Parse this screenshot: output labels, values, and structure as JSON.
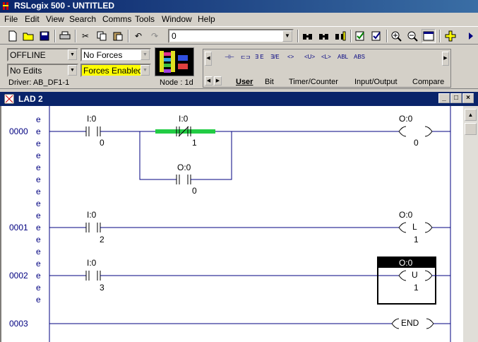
{
  "window": {
    "title": "RSLogix 500 - UNTITLED"
  },
  "menu": [
    "File",
    "Edit",
    "View",
    "Search",
    "Comms",
    "Tools",
    "Window",
    "Help"
  ],
  "toolbar": {
    "combo_value": "0"
  },
  "status": {
    "mode": "OFFLINE",
    "edits": "No Edits",
    "forces": "No Forces",
    "forces_enabled": "Forces Enabled",
    "driver": "Driver: AB_DF1-1",
    "node": "Node :  1d"
  },
  "palette": {
    "icons": [
      "⊣⊢",
      "⊏⊐",
      "∃ E",
      "∃/E",
      "<>",
      "<U>",
      "<L>",
      "ABL",
      "ABS"
    ],
    "tabs": [
      "User",
      "Bit",
      "Timer/Counter",
      "Input/Output",
      "Compare"
    ]
  },
  "lad": {
    "title": "LAD 2"
  },
  "rungs": [
    {
      "number": "0000"
    },
    {
      "number": "0001"
    },
    {
      "number": "0002"
    },
    {
      "number": "0003"
    }
  ],
  "instructions": {
    "r0_xic_file": "I:0",
    "r0_xic_bit": "0",
    "r0_xio_file": "I:0",
    "r0_xio_bit": "1",
    "r0_branch_file": "O:0",
    "r0_branch_bit": "0",
    "r0_ote_file": "O:0",
    "r0_ote_bit": "0",
    "r1_xic_file": "I:0",
    "r1_xic_bit": "2",
    "r1_otl_file": "O:0",
    "r1_otl_bit": "1",
    "r1_otl_letter": "L",
    "r2_xic_file": "I:0",
    "r2_xic_bit": "3",
    "r2_otu_file": "O:0",
    "r2_otu_bit": "1",
    "r2_otu_letter": "U",
    "r3_end": "END"
  },
  "e_mark": "e",
  "colors": {
    "title_bar": "#0a246a",
    "rung_wire": "#000080",
    "force_highlight": "#22cc44",
    "forces_enabled_bg": "#ffff00"
  }
}
